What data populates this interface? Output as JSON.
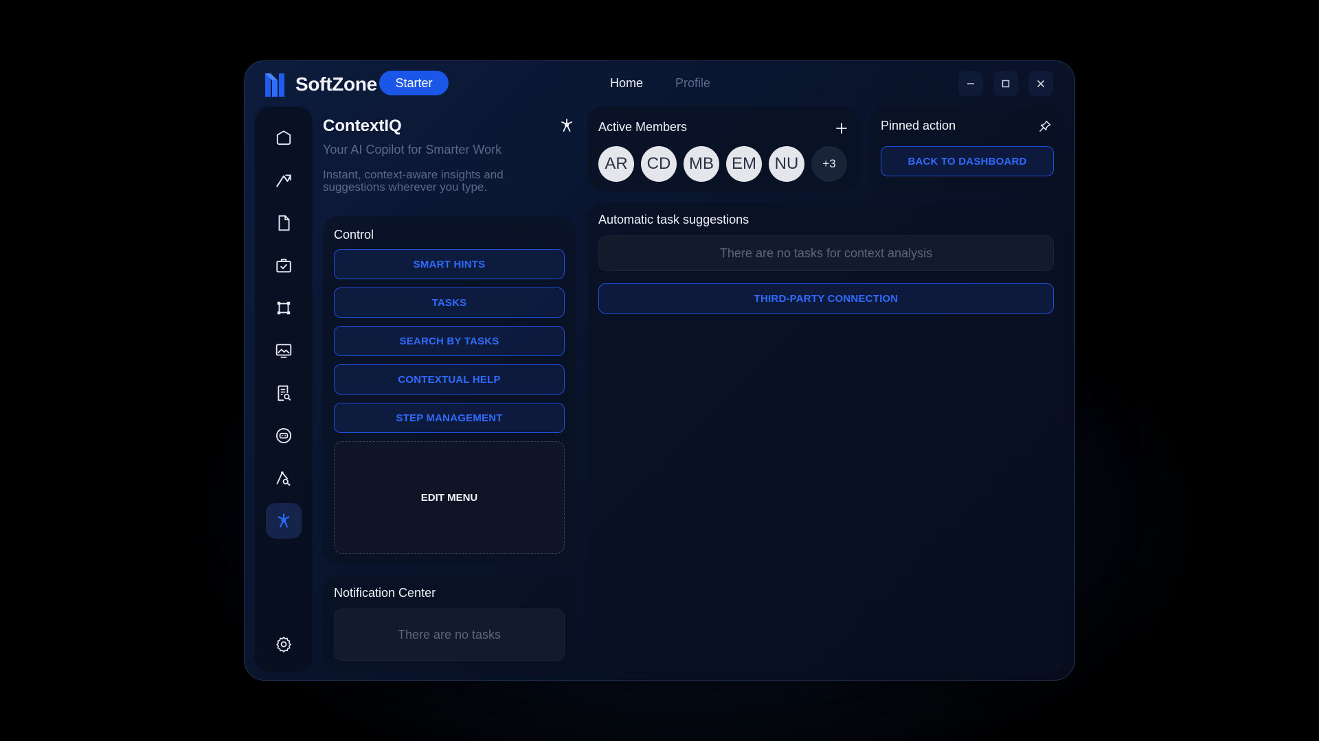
{
  "app": {
    "brand": "SoftZone",
    "plan_badge": "Starter",
    "nav": {
      "home": "Home",
      "profile": "Profile"
    }
  },
  "header": {
    "title": "ContextIQ",
    "subtitle": "Your AI Copilot for Smarter Work",
    "description": "Instant, context-aware insights and suggestions wherever you type."
  },
  "sidebar": {
    "items": [
      {
        "icon": "home-icon"
      },
      {
        "icon": "trend-icon"
      },
      {
        "icon": "document-icon"
      },
      {
        "icon": "briefcase-check-icon"
      },
      {
        "icon": "frame-icon"
      },
      {
        "icon": "monitor-image-icon"
      },
      {
        "icon": "report-search-icon"
      },
      {
        "icon": "chat-bubble-icon"
      },
      {
        "icon": "vector-pen-icon"
      },
      {
        "icon": "sparkle-icon",
        "active": true
      },
      {
        "icon": "gear-icon"
      }
    ]
  },
  "members": {
    "title": "Active Members",
    "avatars": [
      "AR",
      "CD",
      "MB",
      "EM",
      "NU"
    ],
    "more": "+3"
  },
  "pinned": {
    "title": "Pinned action",
    "button": "BACK TO DASHBOARD"
  },
  "control": {
    "title": "Control",
    "buttons": [
      "SMART HINTS",
      "TASKS",
      "SEARCH BY TASKS",
      "CONTEXTUAL HELP",
      "STEP MANAGEMENT"
    ],
    "edit_menu": "EDIT MENU"
  },
  "notifications": {
    "title": "Notification Center",
    "empty": "There are no tasks"
  },
  "tasks": {
    "title": "Automatic task suggestions",
    "empty": "There are no tasks for context analysis",
    "connect_button": "THIRD-PARTY CONNECTION"
  },
  "colors": {
    "accent": "#1a57e8",
    "accent_text": "#2f6bff",
    "muted_text": "#5d6a87"
  }
}
